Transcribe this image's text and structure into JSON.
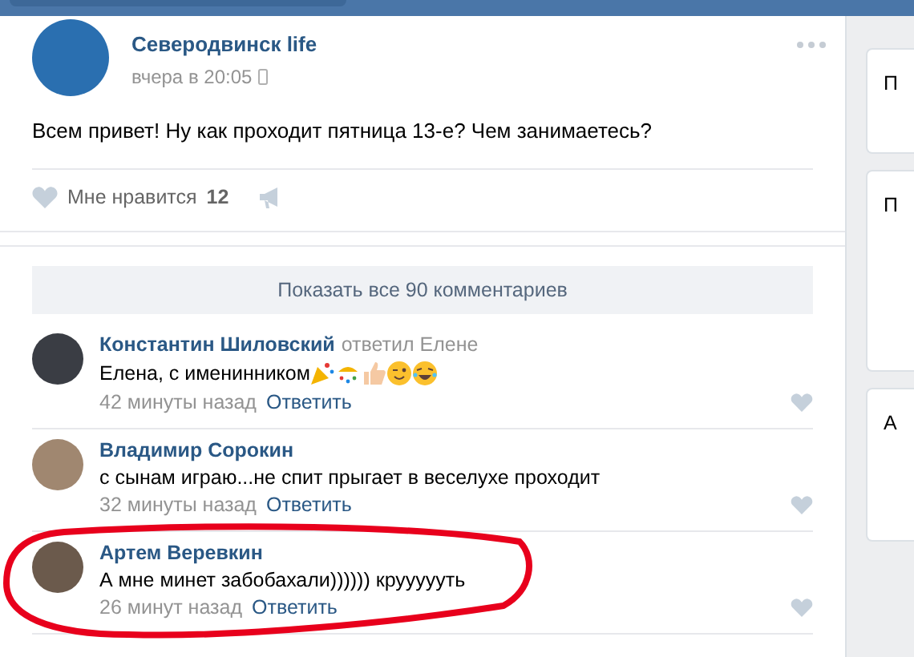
{
  "post": {
    "author": "Северодвинск life",
    "time": "вчера в 20:05",
    "text": "Всем привет! Ну как проходит пятница 13-е? Чем занимаетесь?",
    "like_label": "Мне нравится",
    "like_count": "12"
  },
  "show_all": "Показать все 90 комментариев",
  "comments": [
    {
      "author": "Константин Шиловский",
      "reply_to": "ответил Елене",
      "text": "Елена, с именинником",
      "kind": "with-emoji",
      "time": "42 минуты назад",
      "reply": "Ответить",
      "highlighted": false
    },
    {
      "author": "Владимир Сорокин",
      "kind": "plain",
      "text": "с сынам играю...не спит прыгает в веселухе проходит",
      "time": "32 минуты назад",
      "reply": "Ответить",
      "highlighted": false
    },
    {
      "author": "Артем Веревкин",
      "kind": "plain",
      "text": "А мне минет забобахали)))))) круууууть",
      "time": "26 минут назад",
      "reply": "Ответить",
      "highlighted": true
    }
  ],
  "sidebar": [
    "П",
    "П",
    "А"
  ]
}
